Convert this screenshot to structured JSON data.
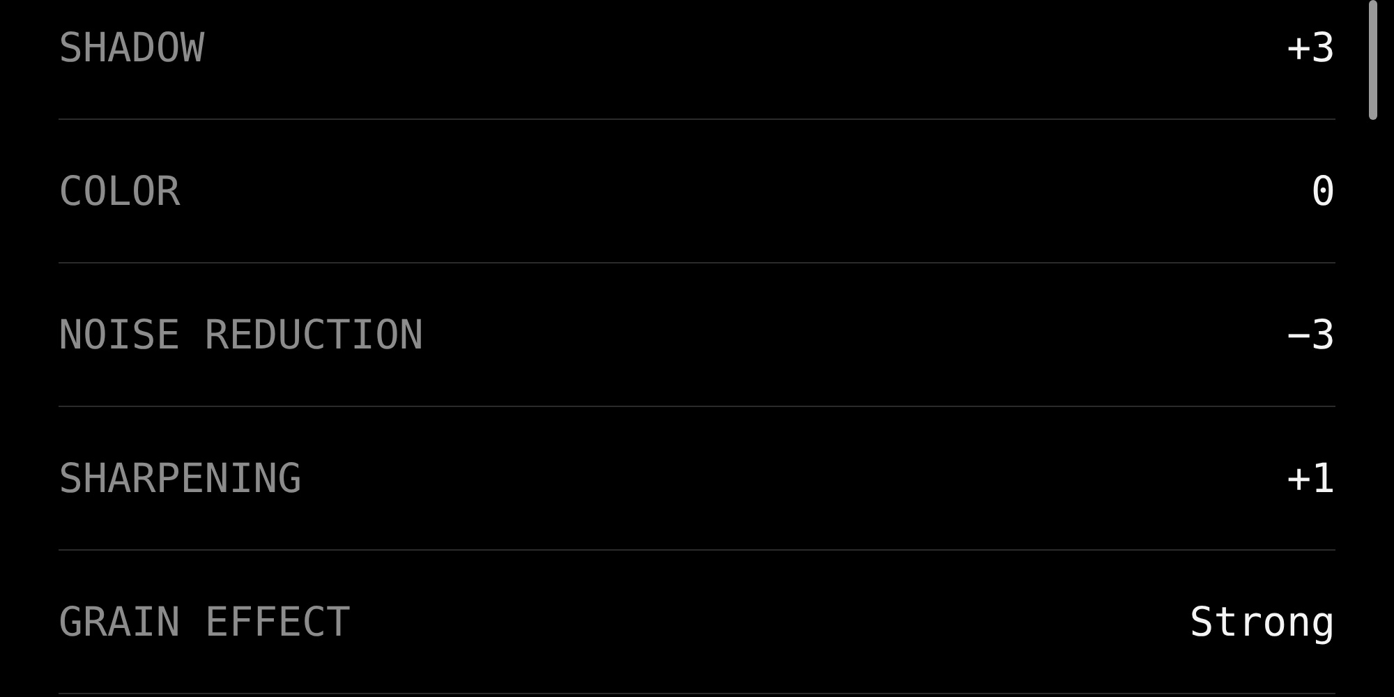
{
  "settings": [
    {
      "label": "SHADOW",
      "value": "+3"
    },
    {
      "label": "COLOR",
      "value": "0"
    },
    {
      "label": "NOISE REDUCTION",
      "value": "−3"
    },
    {
      "label": "SHARPENING",
      "value": "+1"
    },
    {
      "label": "GRAIN EFFECT",
      "value": "Strong"
    }
  ]
}
